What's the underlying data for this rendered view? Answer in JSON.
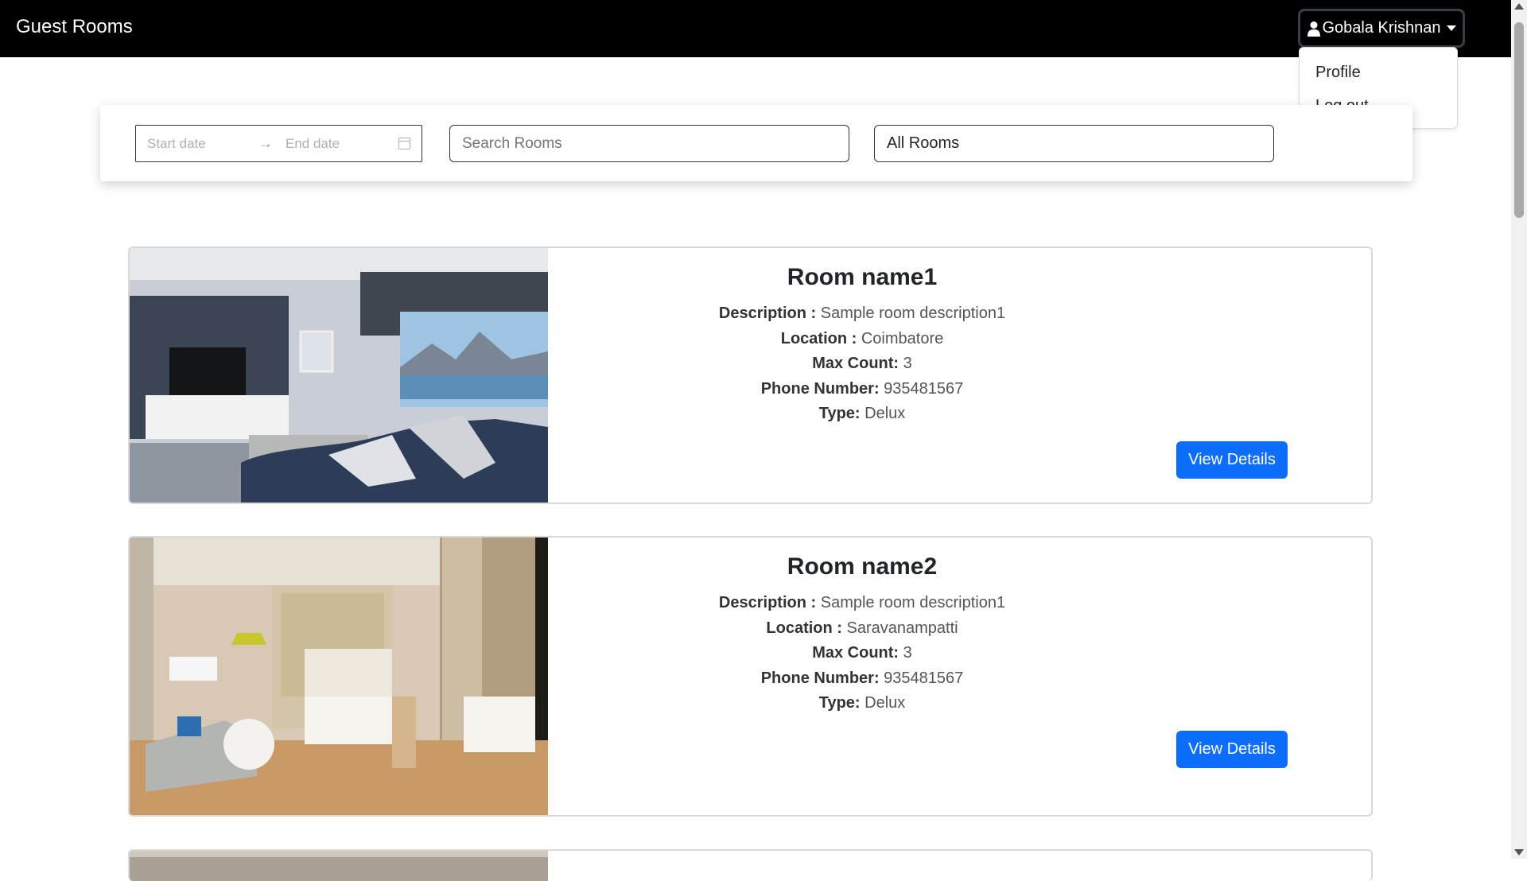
{
  "navbar": {
    "brand": "Guest Rooms",
    "user_name": "Gobala Krishnan",
    "menu": [
      "Profile",
      "Log out"
    ]
  },
  "filters": {
    "start_placeholder": "Start date",
    "end_placeholder": "End date",
    "search_placeholder": "Search Rooms",
    "room_filter": "All Rooms"
  },
  "labels": {
    "description": "Description :",
    "location": "Location :",
    "max_count": "Max Count:",
    "phone": "Phone Number:",
    "type": "Type:",
    "view_details": "View Details"
  },
  "rooms": [
    {
      "name": "Room name1",
      "description": "Sample room description1",
      "location": "Coimbatore",
      "max_count": "3",
      "phone": "935481567",
      "type": "Delux"
    },
    {
      "name": "Room name2",
      "description": "Sample room description1",
      "location": "Saravanampatti",
      "max_count": "3",
      "phone": "935481567",
      "type": "Delux"
    }
  ],
  "colors": {
    "navbar_bg": "#000000",
    "primary": "#0d6efd"
  }
}
